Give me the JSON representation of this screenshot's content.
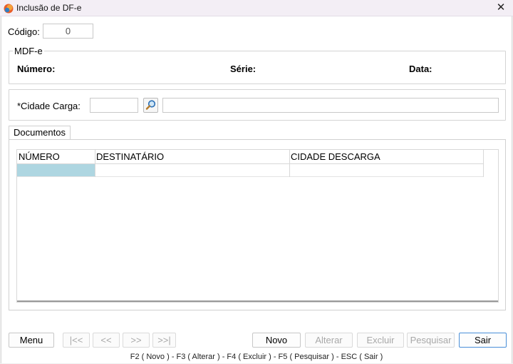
{
  "window": {
    "title": "Inclusão de DF-e",
    "close_glyph": "✕"
  },
  "codigo": {
    "label": "Código:",
    "value": "0"
  },
  "mdfe": {
    "legend": "MDF-e",
    "numero_label": "Número:",
    "serie_label": "Série:",
    "data_label": "Data:"
  },
  "carga": {
    "label": "*Cidade Carga:",
    "code_value": "",
    "name_value": ""
  },
  "tabs": [
    {
      "label": "Documentos"
    }
  ],
  "grid": {
    "columns": [
      "NÚMERO",
      "DESTINATÁRIO",
      "CIDADE DESCARGA"
    ],
    "rows": [
      [
        "",
        "",
        ""
      ]
    ],
    "selected_color": "#aed6e1"
  },
  "nav": {
    "menu": "Menu",
    "first": "|<<",
    "prev": "<<",
    "next": ">>",
    "last": ">>|"
  },
  "actions": {
    "novo": "Novo",
    "alterar": "Alterar",
    "excluir": "Excluir",
    "pesquisar": "Pesquisar",
    "sair": "Sair"
  },
  "status": "F2 ( Novo )  -  F3 ( Alterar )  -  F4 ( Excluir )  -  F5 ( Pesquisar )  -  ESC ( Sair )",
  "colors": {
    "accent": "#4a8fd8",
    "titlebar": "#f3eef5"
  }
}
